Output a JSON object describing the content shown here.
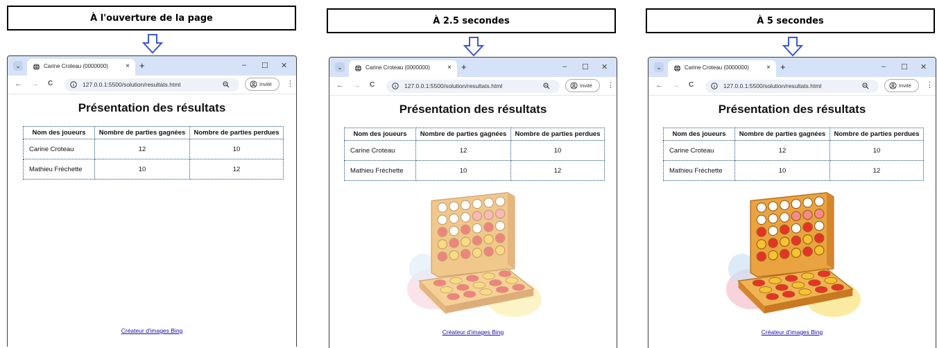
{
  "captions": [
    "À l'ouverture de la page",
    "À 2.5 secondes",
    "À 5 secondes"
  ],
  "browser": {
    "tab_title": "Carine Croteau (0000000)",
    "tab_close": "×",
    "new_tab": "+",
    "url": "127.0.0.1:5500/solution/resultats.html",
    "guest_label": "Invité",
    "win_minimize": "–",
    "win_maximize": "☐",
    "win_close": "✕",
    "back": "←",
    "forward": "→",
    "reload": "C",
    "menu": "⋮"
  },
  "page": {
    "title": "Présentation des résultats",
    "columns": [
      "Nom des joueurs",
      "Nombre de parties gagnées",
      "Nombre de parties perdues"
    ],
    "rows": [
      [
        "Carine Croteau",
        "12",
        "10"
      ],
      [
        "Mathieu Fréchette",
        "10",
        "12"
      ]
    ],
    "credit": "Créateur d'images Bing"
  },
  "image_opacity": [
    0,
    0.6,
    1
  ],
  "colors": {
    "accent_tab": "#d6e2f7",
    "table_border": "#1a4c7a",
    "link": "#1a0dab",
    "arrow": "#3b55d6"
  }
}
